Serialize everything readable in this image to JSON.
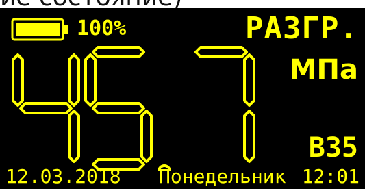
{
  "header_text": "ие состояние)",
  "battery": {
    "percent": "100%",
    "level": 1.0
  },
  "mode": "РАЗГР.",
  "unit": "МПа",
  "strength_class": "B35",
  "reading": "45.7",
  "footer": {
    "date": "12.03.2018",
    "weekday": "Понедельник",
    "time": "12:01"
  },
  "colors": {
    "display_bg": "#000000",
    "display_fg": "#ffff00"
  }
}
